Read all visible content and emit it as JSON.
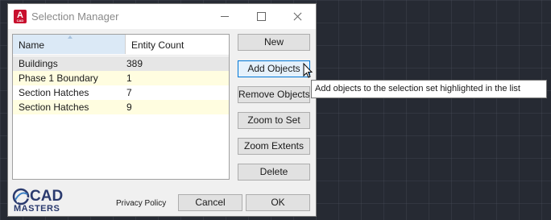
{
  "window": {
    "title": "Selection Manager",
    "app_icon_letter": "A",
    "app_icon_caption": "CAD"
  },
  "list": {
    "columns": [
      "Name",
      "Entity Count"
    ],
    "rows": [
      {
        "name": "Buildings",
        "count": "389"
      },
      {
        "name": "Phase 1 Boundary",
        "count": "1"
      },
      {
        "name": "Section Hatches",
        "count": "7"
      },
      {
        "name": "Section Hatches",
        "count": "9"
      }
    ]
  },
  "buttons": {
    "new": "New",
    "add_objects": "Add Objects",
    "remove_objects": "Remove Objects",
    "zoom_to_set": "Zoom to Set",
    "zoom_extents": "Zoom Extents",
    "delete": "Delete",
    "cancel": "Cancel",
    "ok": "OK"
  },
  "footer": {
    "privacy": "Privacy Policy"
  },
  "logo": {
    "line1": "CAD",
    "line2": "MASTERS"
  },
  "tooltip": {
    "text": "Add objects to the selection set highlighted in the list"
  },
  "colors": {
    "alt_row": "#fffde0",
    "selected_row": "#e6e6e6",
    "hover_button": "#e5f1fb",
    "hover_border": "#0078d7",
    "brand": "#2a3a6e",
    "app_icon": "#c8102e"
  },
  "icons": {
    "app": "autocad-app-icon",
    "minimize": "minimize-icon",
    "maximize": "maximize-icon",
    "close": "close-icon",
    "sort": "sort-ascending-icon",
    "cursor": "mouse-pointer-icon"
  }
}
